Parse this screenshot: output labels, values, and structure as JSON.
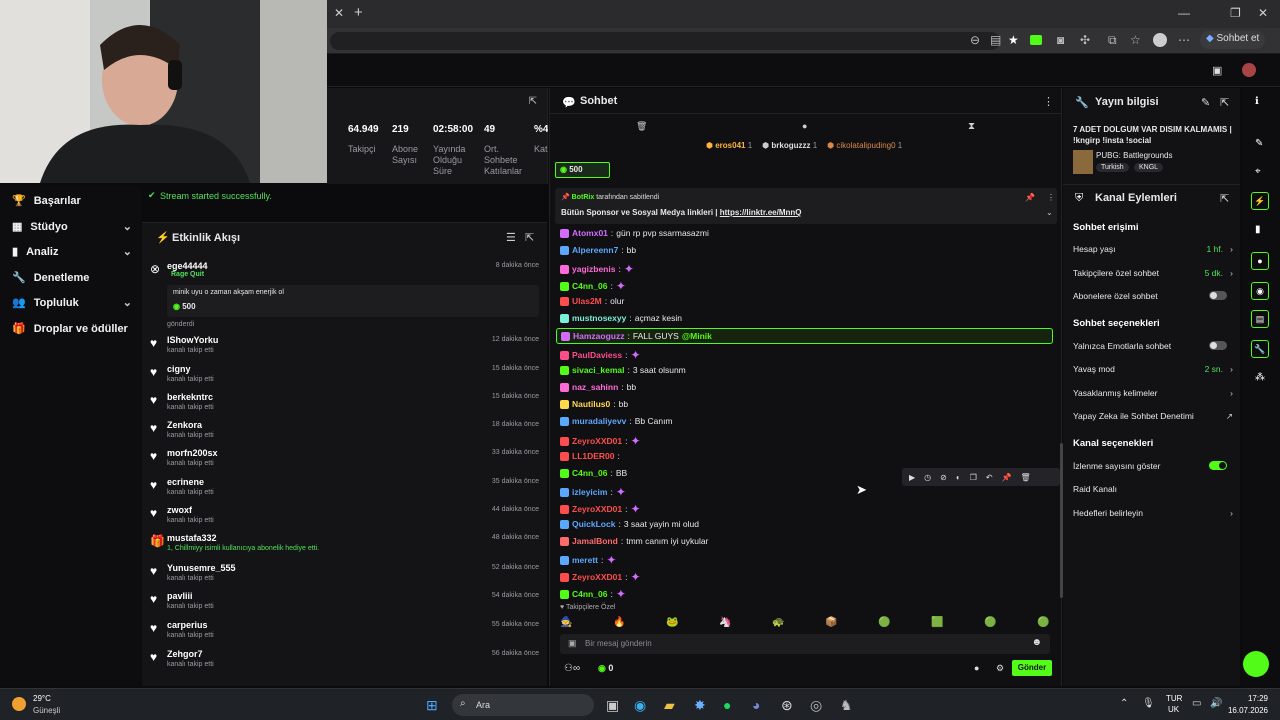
{
  "browser": {
    "new_tab": "+",
    "chat_button": "Sohbet et"
  },
  "sidebar": {
    "items": [
      {
        "label": "Başarılar",
        "chevron": false
      },
      {
        "label": "Stüdyo",
        "chevron": true
      },
      {
        "label": "Analiz",
        "chevron": true
      },
      {
        "label": "Denetleme",
        "chevron": false
      },
      {
        "label": "Topluluk",
        "chevron": true
      },
      {
        "label": "Droplar ve ödüller",
        "chevron": false
      }
    ]
  },
  "stats": [
    {
      "value": "64.949",
      "label": "Takipçi"
    },
    {
      "value": "219",
      "label": "Abone Sayısı"
    },
    {
      "value": "02:58:00",
      "label": "Yayında Olduğu Süre"
    },
    {
      "value": "49",
      "label": "Ort. Sohbete Katılanlar"
    },
    {
      "value": "%4",
      "label": "Kat"
    }
  ],
  "toast": "Stream started successfully.",
  "activity": {
    "title": "Etkinlik Akışı",
    "first": {
      "name": "ege44444",
      "tag": "Rage Quit",
      "time": "8 dakika önce",
      "message": "minik uyu o zaman akşam enerjik ol",
      "amount": "500",
      "status": "gönderdi"
    },
    "events": [
      {
        "name": "IShowYorku",
        "sub": "kanalı takip etti",
        "time": "12 dakika önce"
      },
      {
        "name": "cigny",
        "sub": "kanalı takip etti",
        "time": "15 dakika önce"
      },
      {
        "name": "berkekntrc",
        "sub": "kanalı takip etti",
        "time": "15 dakika önce"
      },
      {
        "name": "Zenkora",
        "sub": "kanalı takip etti",
        "time": "18 dakika önce"
      },
      {
        "name": "morfn200sx",
        "sub": "kanalı takip etti",
        "time": "33 dakika önce"
      },
      {
        "name": "ecrinene",
        "sub": "kanalı takip etti",
        "time": "35 dakika önce"
      },
      {
        "name": "zwoxf",
        "sub": "kanalı takip etti",
        "time": "44 dakika önce"
      },
      {
        "name": "mustafa332",
        "sub": "1, Chillmiyy isimli kullanıcıya abonelik hediye etti.",
        "time": "48 dakika önce"
      },
      {
        "name": "Yunusemre_555",
        "sub": "kanalı takip etti",
        "time": "52 dakika önce"
      },
      {
        "name": "pavliii",
        "sub": "kanalı takip etti",
        "time": "54 dakika önce"
      },
      {
        "name": "carperius",
        "sub": "kanalı takip etti",
        "time": "55 dakika önce"
      },
      {
        "name": "Zehgor7",
        "sub": "kanalı takip etti",
        "time": "56 dakika önce"
      }
    ]
  },
  "chat": {
    "title": "Sohbet",
    "top_gifters": [
      {
        "name": "eros041",
        "count": "1"
      },
      {
        "name": "brkoguzzz",
        "count": "1"
      },
      {
        "name": "cikolatalipuding0",
        "count": "1"
      }
    ],
    "kicks_pill": "500",
    "pinned": {
      "by": "BotRix",
      "by_suffix": "tarafından sabitlendi",
      "text": "Bütün Sponsor ve Sosyal Medya linkleri |",
      "link": "https://linktr.ee/MnnQ"
    },
    "messages": [
      {
        "user": "Atomx01",
        "color": "#d46bff",
        "text": "gün rp pvp ssarmasazmi",
        "emote": false
      },
      {
        "user": "Alpereenn7",
        "color": "#5aa8ff",
        "text": "bb",
        "emote": false
      },
      {
        "user": "yagizbenis",
        "color": "#ff6bd6",
        "text": "",
        "emote": true
      },
      {
        "user": "C4nn_06",
        "color": "#53fc18",
        "text": "",
        "emote": true
      },
      {
        "user": "Ulas2M",
        "color": "#ff4d4d",
        "text": "olur",
        "emote": false
      },
      {
        "user": "mustnosexyy",
        "color": "#7af0d8",
        "text": "açmaz kesin",
        "emote": false
      },
      {
        "user": "Hamzaoguzz",
        "color": "#d46bff",
        "text": "FALL GUYS ",
        "mention": "@Minik",
        "emote": false,
        "highlight": true
      },
      {
        "user": "PaulDaviess",
        "color": "#ff4d8a",
        "text": "",
        "emote": true
      },
      {
        "user": "sivaci_kemal",
        "color": "#53fc18",
        "text": "3 saat olsunm",
        "emote": false
      },
      {
        "user": "naz_sahinn",
        "color": "#ff6bd6",
        "text": "bb",
        "emote": false
      },
      {
        "user": "Nautilus0",
        "color": "#ffd84d",
        "text": "bb",
        "emote": false
      },
      {
        "user": "muradaliyevv",
        "color": "#5aa8ff",
        "text": "Bb Canım",
        "emote": false
      },
      {
        "user": "ZeyroXXD01",
        "color": "#ff4d4d",
        "text": "",
        "emote": true
      },
      {
        "user": "LL1DER00",
        "color": "#ff4d4d",
        "text": "",
        "emote": false
      },
      {
        "user": "C4nn_06",
        "color": "#53fc18",
        "text": "BB",
        "emote": false
      },
      {
        "user": "izleyicim",
        "color": "#5aa8ff",
        "text": "",
        "emote": true
      },
      {
        "user": "ZeyroXXD01",
        "color": "#ff4d4d",
        "text": "",
        "emote": true
      },
      {
        "user": "QuickLock",
        "color": "#5aa8ff",
        "text": "3 saat yayin mi olud",
        "emote": false
      },
      {
        "user": "JamalBond",
        "color": "#ff6b6b",
        "text": "tmm canım iyi uykular",
        "emote": false
      },
      {
        "user": "merett",
        "color": "#5aa8ff",
        "text": "",
        "emote": true
      },
      {
        "user": "ZeyroXXD01",
        "color": "#ff4d4d",
        "text": "",
        "emote": true
      },
      {
        "user": "C4nn_06",
        "color": "#53fc18",
        "text": "",
        "emote": true
      }
    ],
    "followers_only": "Takipçilere Özel",
    "input_placeholder": "Bir mesaj gönderin",
    "kicks_count": "0",
    "send": "Gönder"
  },
  "stream_info": {
    "title": "Yayın bilgisi",
    "stream_title": "7 ADET DOLGUM VAR DISIM KALMAMIS | !kngirp !insta !social",
    "category": "PUBG: Battlegrounds",
    "tags": [
      "Turkish",
      "KNGL"
    ]
  },
  "channel_actions": {
    "title": "Kanal Eylemleri",
    "chat_access": "Sohbet erişimi",
    "account_age": {
      "label": "Hesap yaşı",
      "value": "1 hf."
    },
    "followers_only": {
      "label": "Takipçilere özel sohbet",
      "value": "5 dk."
    },
    "subs_only": "Abonelere özel sohbet",
    "chat_options": "Sohbet seçenekleri",
    "emotes_only": "Yalnızca Emotlarla sohbet",
    "slow_mode": {
      "label": "Yavaş mod",
      "value": "2 sn."
    },
    "banned_words": "Yasaklanmış kelimeler",
    "ai_moderation": "Yapay Zeka ile Sohbet Denetimi",
    "channel_options": "Kanal seçenekleri",
    "show_viewers": "İzlenme sayısını göster",
    "raid": "Raid Kanalı",
    "goals": "Hedefleri belirleyin"
  },
  "taskbar": {
    "temp": "29°C",
    "weather": "Güneşli",
    "search": "Ara",
    "lang1": "TUR",
    "lang2": "UK",
    "time": "17:29",
    "date": "16.07.2026"
  },
  "colors": {
    "accent": "#53fc18",
    "panel": "#141416"
  }
}
